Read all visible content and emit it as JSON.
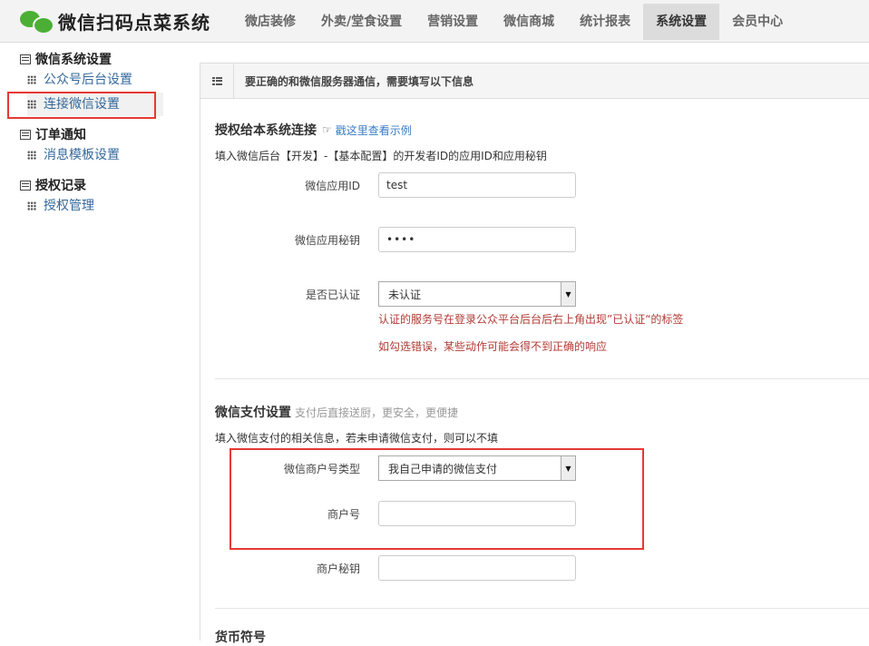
{
  "app": {
    "title": "微信扫码点菜系统",
    "logo_icon": "wechat-logo-icon"
  },
  "nav": {
    "items": [
      "微店装修",
      "外卖/堂食设置",
      "营销设置",
      "微信商城",
      "统计报表",
      "系统设置",
      "会员中心"
    ],
    "active": "系统设置"
  },
  "sidebar": {
    "groups": [
      {
        "title": "微信系统设置",
        "items": [
          "公众号后台设置",
          "连接微信设置"
        ]
      },
      {
        "title": "订单通知",
        "items": [
          "消息模板设置"
        ]
      },
      {
        "title": "授权记录",
        "items": [
          "授权管理"
        ]
      }
    ],
    "active_item": "连接微信设置"
  },
  "panel": {
    "header": "要正确的和微信服务器通信，需要填写以下信息",
    "auth": {
      "title": "授权给本系统连接",
      "link": "戳这里查看示例",
      "desc": "填入微信后台【开发】-【基本配置】的开发者ID的应用ID和应用秘钥",
      "app_id": {
        "label": "微信应用ID",
        "value": "test"
      },
      "app_secret": {
        "label": "微信应用秘钥",
        "value": "••••"
      },
      "verified": {
        "label": "是否已认证",
        "value": "未认证"
      },
      "warn1": "认证的服务号在登录公众平台后台后右上角出现”已认证“的标签",
      "warn2": "如勾选错误，某些动作可能会得不到正确的响应"
    },
    "pay": {
      "title": "微信支付设置",
      "subtitle": "支付后直接送厨，更安全，更便捷",
      "desc": "填入微信支付的相关信息，若未申请微信支付，则可以不填",
      "merchant_type": {
        "label": "微信商户号类型",
        "value": "我自己申请的微信支付"
      },
      "merchant_id": {
        "label": "商户号",
        "value": ""
      },
      "merchant_secret": {
        "label": "商户秘钥",
        "value": ""
      }
    },
    "currency": {
      "title": "货币符号"
    }
  },
  "colors": {
    "accent_red": "#e53935",
    "link_blue": "#35689b",
    "warn_red": "#b23b35",
    "brand_green": "#4caf35"
  }
}
